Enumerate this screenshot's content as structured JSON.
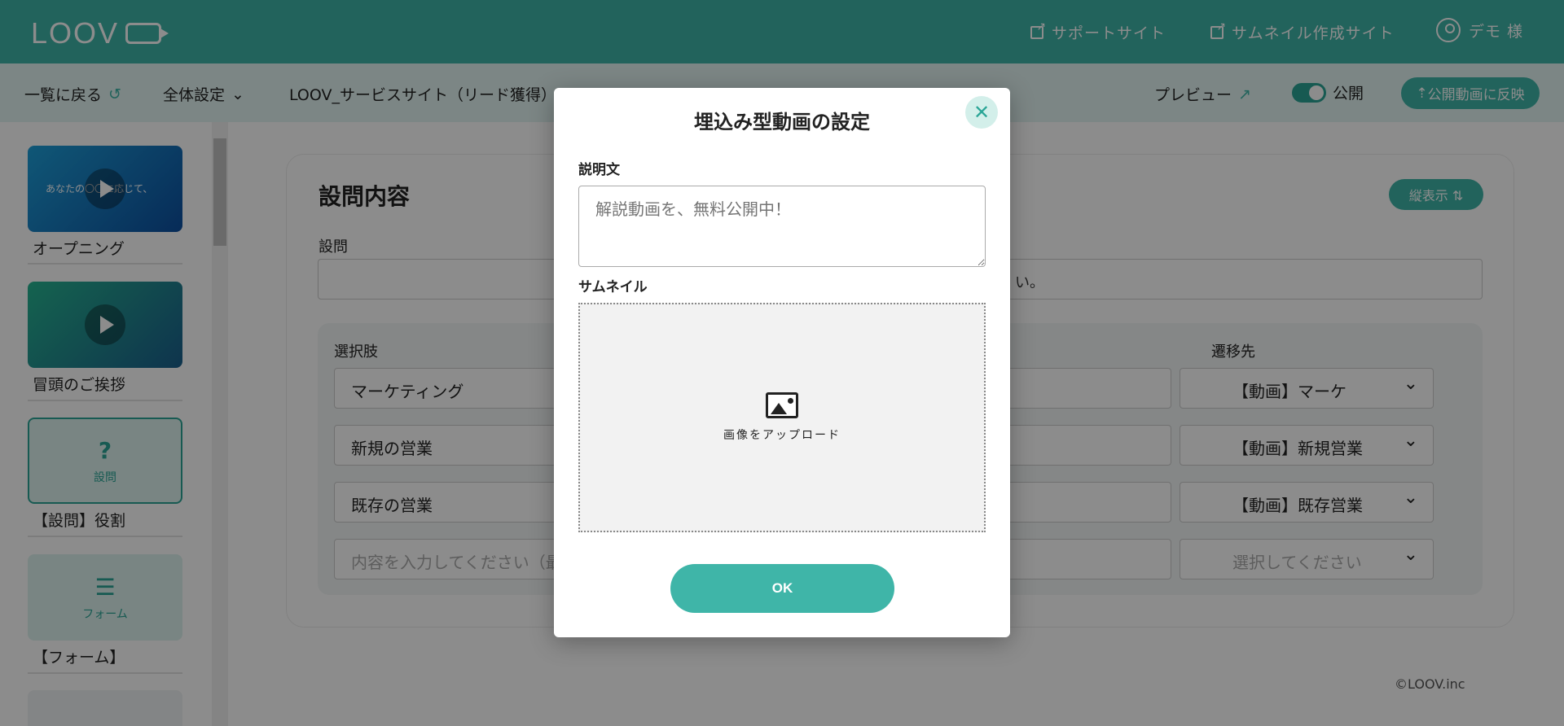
{
  "header": {
    "logo": "LOOV",
    "support_link": "サポートサイト",
    "thumbnail_link": "サムネイル作成サイト",
    "user": "デモ 様"
  },
  "subbar": {
    "back": "一覧に戻る",
    "settings": "全体設定",
    "project_title": "LOOV_サービスサイト（リード獲得）",
    "preview": "プレビュー",
    "public_label": "公開",
    "reflect_button": "公開動画に反映"
  },
  "sidebar": {
    "scenes": [
      {
        "label": "オープニング",
        "thumb_text": "あなたの〇〇に応じて、"
      },
      {
        "label": "冒頭のご挨拶"
      },
      {
        "label": "【設問】役割",
        "thumb_icon": "?",
        "thumb_text": "設問"
      },
      {
        "label": "【フォーム】",
        "thumb_text": "フォーム"
      }
    ]
  },
  "main": {
    "heading": "設問内容",
    "vertical_button": "縦表示 ⇅",
    "question_label": "設問",
    "question_value": "い。",
    "choices_header": "選択肢",
    "dest_header": "遷移先",
    "choices": [
      {
        "text": "マーケティング",
        "dest": "【動画】マーケ"
      },
      {
        "text": "新規の営業",
        "dest": "【動画】新規営業"
      },
      {
        "text": "既存の営業",
        "dest": "【動画】既存営業"
      }
    ],
    "new_choice_placeholder": "内容を入力してください（最",
    "new_dest_placeholder": "選択してください",
    "copyright": "©LOOV.inc"
  },
  "modal": {
    "title": "埋込み型動画の設定",
    "close_icon": "close-icon",
    "description_label": "説明文",
    "description_placeholder": "解説動画を、無料公開中！",
    "thumbnail_label": "サムネイル",
    "upload_text": "画像をアップロード",
    "ok_button": "OK"
  },
  "colors": {
    "accent": "#3fb5a8",
    "accent_dark": "#2aa596",
    "overlay": "rgba(0,0,0,0.45)"
  }
}
